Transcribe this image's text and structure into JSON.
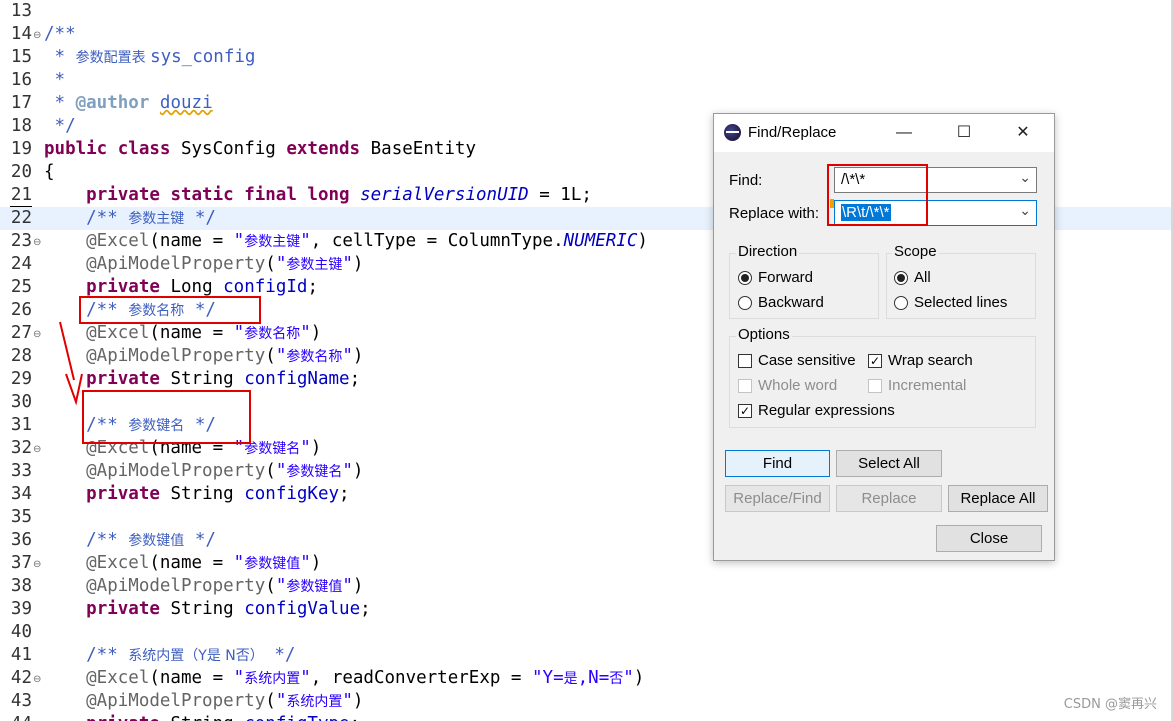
{
  "editor": {
    "lines": [
      {
        "num": "13",
        "fold": "",
        "code": []
      },
      {
        "num": "14",
        "fold": "⊖",
        "code": [
          {
            "t": "/**",
            "c": "cm"
          }
        ]
      },
      {
        "num": "15",
        "fold": "",
        "code": [
          {
            "t": " * ",
            "c": "cm"
          },
          {
            "t": "参数配置表 ",
            "c": "cmz"
          },
          {
            "t": "sys_config",
            "c": "cm"
          }
        ]
      },
      {
        "num": "16",
        "fold": "",
        "code": [
          {
            "t": " *",
            "c": "cm"
          }
        ]
      },
      {
        "num": "17",
        "fold": "",
        "code": [
          {
            "t": " * ",
            "c": "cm"
          },
          {
            "t": "@author",
            "c": "tag"
          },
          {
            "t": " ",
            "c": "cm"
          },
          {
            "t": "douzi",
            "c": "cm squig"
          }
        ]
      },
      {
        "num": "18",
        "fold": "",
        "code": [
          {
            "t": " */",
            "c": "cm"
          }
        ]
      },
      {
        "num": "19",
        "fold": "",
        "code": [
          {
            "t": "public class",
            "c": "kw"
          },
          {
            "t": " SysConfig ",
            "c": ""
          },
          {
            "t": "extends",
            "c": "kw"
          },
          {
            "t": " BaseEntity",
            "c": ""
          }
        ]
      },
      {
        "num": "20",
        "fold": "",
        "code": [
          {
            "t": "{",
            "c": ""
          }
        ]
      },
      {
        "num": "21",
        "fold": "",
        "code": [
          {
            "t": "    ",
            "c": ""
          },
          {
            "t": "private static final long",
            "c": "kw"
          },
          {
            "t": " ",
            "c": ""
          },
          {
            "t": "serialVersionUID",
            "c": "sfld"
          },
          {
            "t": " = 1L;",
            "c": ""
          }
        ]
      },
      {
        "num": "22",
        "fold": "",
        "current": true,
        "code": [
          {
            "t": "    /** ",
            "c": "cm"
          },
          {
            "t": "参数主键",
            "c": "cmz"
          },
          {
            "t": " */",
            "c": "cm"
          }
        ]
      },
      {
        "num": "23",
        "fold": "⊖",
        "code": [
          {
            "t": "    @Excel",
            "c": "an"
          },
          {
            "t": "(name = ",
            "c": ""
          },
          {
            "t": "\"",
            "c": "st"
          },
          {
            "t": "参数主键",
            "c": "stz"
          },
          {
            "t": "\"",
            "c": "st"
          },
          {
            "t": ", cellType = ColumnType.",
            "c": ""
          },
          {
            "t": "NUMERIC",
            "c": "sfld"
          },
          {
            "t": ")",
            "c": ""
          }
        ]
      },
      {
        "num": "24",
        "fold": "",
        "code": [
          {
            "t": "    @ApiModelProperty",
            "c": "an"
          },
          {
            "t": "(",
            "c": ""
          },
          {
            "t": "\"",
            "c": "st"
          },
          {
            "t": "参数主键",
            "c": "stz"
          },
          {
            "t": "\"",
            "c": "st"
          },
          {
            "t": ")",
            "c": ""
          }
        ]
      },
      {
        "num": "25",
        "fold": "",
        "code": [
          {
            "t": "    ",
            "c": ""
          },
          {
            "t": "private",
            "c": "kw"
          },
          {
            "t": " Long ",
            "c": ""
          },
          {
            "t": "configId",
            "c": "fld"
          },
          {
            "t": ";",
            "c": ""
          }
        ]
      },
      {
        "num": "26",
        "fold": "",
        "code": [
          {
            "t": "    /** ",
            "c": "cm"
          },
          {
            "t": "参数名称",
            "c": "cmz"
          },
          {
            "t": " */",
            "c": "cm"
          }
        ]
      },
      {
        "num": "27",
        "fold": "⊖",
        "code": [
          {
            "t": "    @Excel",
            "c": "an"
          },
          {
            "t": "(name = ",
            "c": ""
          },
          {
            "t": "\"",
            "c": "st"
          },
          {
            "t": "参数名称",
            "c": "stz"
          },
          {
            "t": "\"",
            "c": "st"
          },
          {
            "t": ")",
            "c": ""
          }
        ]
      },
      {
        "num": "28",
        "fold": "",
        "code": [
          {
            "t": "    @ApiModelProperty",
            "c": "an"
          },
          {
            "t": "(",
            "c": ""
          },
          {
            "t": "\"",
            "c": "st"
          },
          {
            "t": "参数名称",
            "c": "stz"
          },
          {
            "t": "\"",
            "c": "st"
          },
          {
            "t": ")",
            "c": ""
          }
        ]
      },
      {
        "num": "29",
        "fold": "",
        "code": [
          {
            "t": "    ",
            "c": ""
          },
          {
            "t": "private",
            "c": "kw"
          },
          {
            "t": " String ",
            "c": ""
          },
          {
            "t": "configName",
            "c": "fld"
          },
          {
            "t": ";",
            "c": ""
          }
        ]
      },
      {
        "num": "30",
        "fold": "",
        "code": []
      },
      {
        "num": "31",
        "fold": "",
        "code": [
          {
            "t": "    /** ",
            "c": "cm"
          },
          {
            "t": "参数键名",
            "c": "cmz"
          },
          {
            "t": " */",
            "c": "cm"
          }
        ]
      },
      {
        "num": "32",
        "fold": "⊖",
        "code": [
          {
            "t": "    @Excel",
            "c": "an"
          },
          {
            "t": "(name = ",
            "c": ""
          },
          {
            "t": "\"",
            "c": "st"
          },
          {
            "t": "参数键名",
            "c": "stz"
          },
          {
            "t": "\"",
            "c": "st"
          },
          {
            "t": ")",
            "c": ""
          }
        ]
      },
      {
        "num": "33",
        "fold": "",
        "code": [
          {
            "t": "    @ApiModelProperty",
            "c": "an"
          },
          {
            "t": "(",
            "c": ""
          },
          {
            "t": "\"",
            "c": "st"
          },
          {
            "t": "参数键名",
            "c": "stz"
          },
          {
            "t": "\"",
            "c": "st"
          },
          {
            "t": ")",
            "c": ""
          }
        ]
      },
      {
        "num": "34",
        "fold": "",
        "code": [
          {
            "t": "    ",
            "c": ""
          },
          {
            "t": "private",
            "c": "kw"
          },
          {
            "t": " String ",
            "c": ""
          },
          {
            "t": "configKey",
            "c": "fld"
          },
          {
            "t": ";",
            "c": ""
          }
        ]
      },
      {
        "num": "35",
        "fold": "",
        "code": []
      },
      {
        "num": "36",
        "fold": "",
        "code": [
          {
            "t": "    /** ",
            "c": "cm"
          },
          {
            "t": "参数键值",
            "c": "cmz"
          },
          {
            "t": " */",
            "c": "cm"
          }
        ]
      },
      {
        "num": "37",
        "fold": "⊖",
        "code": [
          {
            "t": "    @Excel",
            "c": "an"
          },
          {
            "t": "(name = ",
            "c": ""
          },
          {
            "t": "\"",
            "c": "st"
          },
          {
            "t": "参数键值",
            "c": "stz"
          },
          {
            "t": "\"",
            "c": "st"
          },
          {
            "t": ")",
            "c": ""
          }
        ]
      },
      {
        "num": "38",
        "fold": "",
        "code": [
          {
            "t": "    @ApiModelProperty",
            "c": "an"
          },
          {
            "t": "(",
            "c": ""
          },
          {
            "t": "\"",
            "c": "st"
          },
          {
            "t": "参数键值",
            "c": "stz"
          },
          {
            "t": "\"",
            "c": "st"
          },
          {
            "t": ")",
            "c": ""
          }
        ]
      },
      {
        "num": "39",
        "fold": "",
        "code": [
          {
            "t": "    ",
            "c": ""
          },
          {
            "t": "private",
            "c": "kw"
          },
          {
            "t": " String ",
            "c": ""
          },
          {
            "t": "configValue",
            "c": "fld"
          },
          {
            "t": ";",
            "c": ""
          }
        ]
      },
      {
        "num": "40",
        "fold": "",
        "code": []
      },
      {
        "num": "41",
        "fold": "",
        "code": [
          {
            "t": "    /** ",
            "c": "cm"
          },
          {
            "t": "系统内置（Y是 N否）",
            "c": "cmz"
          },
          {
            "t": " */",
            "c": "cm"
          }
        ]
      },
      {
        "num": "42",
        "fold": "⊖",
        "code": [
          {
            "t": "    @Excel",
            "c": "an"
          },
          {
            "t": "(name = ",
            "c": ""
          },
          {
            "t": "\"",
            "c": "st"
          },
          {
            "t": "系统内置",
            "c": "stz"
          },
          {
            "t": "\"",
            "c": "st"
          },
          {
            "t": ", readConverterExp = ",
            "c": ""
          },
          {
            "t": "\"Y=",
            "c": "st"
          },
          {
            "t": "是",
            "c": "stz"
          },
          {
            "t": ",N=",
            "c": "st"
          },
          {
            "t": "否",
            "c": "stz"
          },
          {
            "t": "\"",
            "c": "st"
          },
          {
            "t": ")",
            "c": ""
          }
        ]
      },
      {
        "num": "43",
        "fold": "",
        "code": [
          {
            "t": "    @ApiModelProperty",
            "c": "an"
          },
          {
            "t": "(",
            "c": ""
          },
          {
            "t": "\"",
            "c": "st"
          },
          {
            "t": "系统内置",
            "c": "stz"
          },
          {
            "t": "\"",
            "c": "st"
          },
          {
            "t": ")",
            "c": ""
          }
        ]
      },
      {
        "num": "44",
        "fold": "",
        "code": [
          {
            "t": "    ",
            "c": ""
          },
          {
            "t": "private",
            "c": "kw"
          },
          {
            "t": " String ",
            "c": ""
          },
          {
            "t": "configType",
            "c": "fld"
          },
          {
            "t": ";",
            "c": ""
          }
        ]
      }
    ]
  },
  "dialog": {
    "title": "Find/Replace",
    "min_symbol": "—",
    "max_symbol": "☐",
    "close_symbol": "✕",
    "find_label": "Find:",
    "find_value": "/\\*\\*",
    "replace_label": "Replace with:",
    "replace_value": "\\R\\t/\\*\\*",
    "direction": {
      "title": "Direction",
      "forward": "Forward",
      "backward": "Backward",
      "selected": "forward"
    },
    "scope": {
      "title": "Scope",
      "all": "All",
      "selected_lines": "Selected lines",
      "selected": "all"
    },
    "options": {
      "title": "Options",
      "case_sensitive": {
        "label": "Case sensitive",
        "checked": false,
        "enabled": true
      },
      "wrap_search": {
        "label": "Wrap search",
        "checked": true,
        "enabled": true
      },
      "whole_word": {
        "label": "Whole word",
        "checked": false,
        "enabled": false
      },
      "incremental": {
        "label": "Incremental",
        "checked": false,
        "enabled": false
      },
      "regular_expressions": {
        "label": "Regular expressions",
        "checked": true,
        "enabled": true
      }
    },
    "buttons": {
      "find": "Find",
      "select_all": "Select All",
      "replace_find": "Replace/Find",
      "replace": "Replace",
      "replace_all": "Replace All",
      "close": "Close"
    }
  },
  "watermark": "CSDN @窦再兴",
  "colors": {
    "annotation_red": "#e00000",
    "selection_blue": "#0078d7",
    "current_line": "#e8f2fe"
  }
}
